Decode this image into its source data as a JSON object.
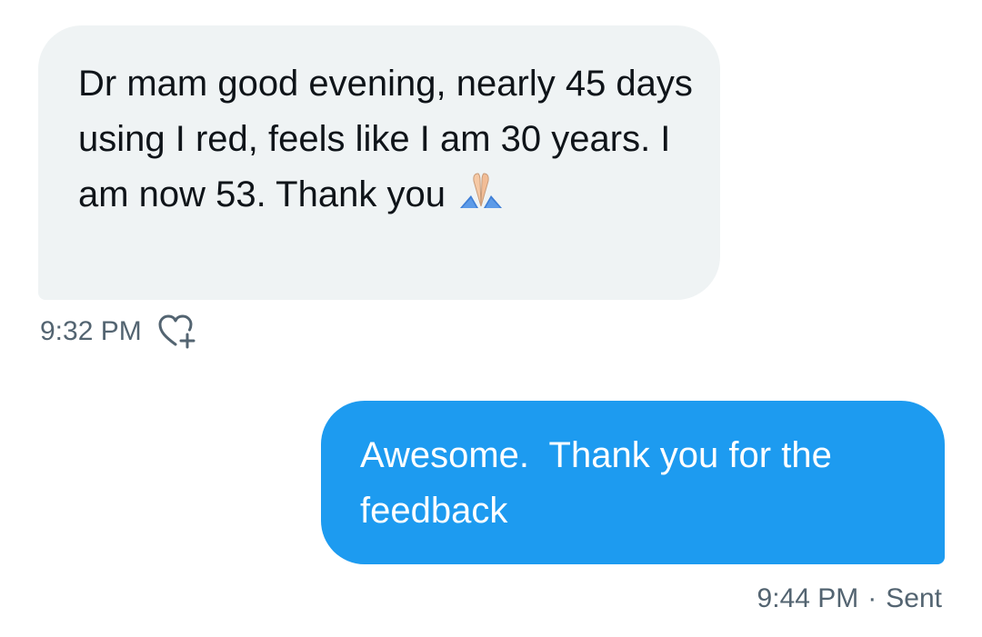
{
  "conversation": {
    "received": {
      "text": "Dr mam good evening, nearly 45 days using I red, feels like I am 30 years. I am now 53. Thank you",
      "emoji": "folded-hands-emoji",
      "time": "9:32 PM",
      "like_icon": "heart-plus-icon"
    },
    "sent": {
      "text": "Awesome.  Thank you for the feedback",
      "time": "9:44 PM",
      "separator": "·",
      "status": "Sent"
    }
  },
  "colors": {
    "received_bubble": "#eff3f4",
    "sent_bubble": "#1d9bf0",
    "meta_text": "#536471"
  }
}
